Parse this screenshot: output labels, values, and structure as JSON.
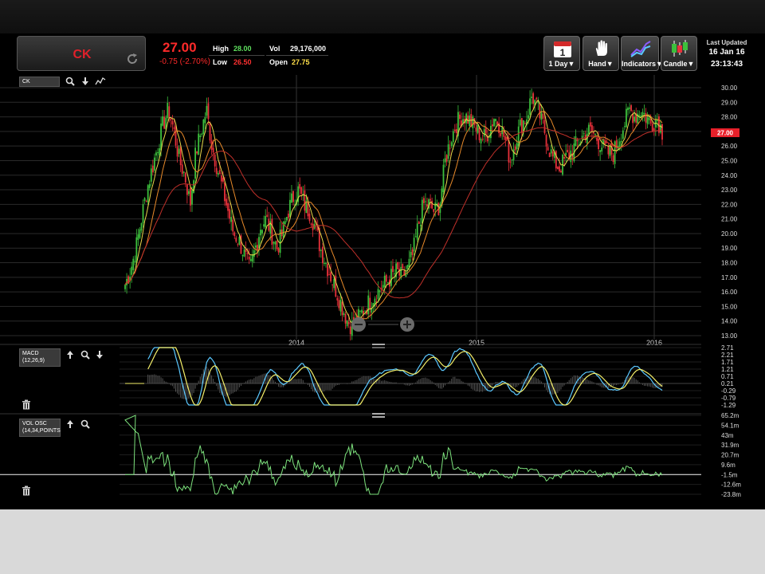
{
  "header": {
    "symbol": "CK",
    "last_price": "27.00",
    "change": "-0.75 (-2.70%)",
    "high_label": "High",
    "high_value": "28.00",
    "low_label": "Low",
    "low_value": "26.50",
    "vol_label": "Vol",
    "vol_value": "29,176,000",
    "open_label": "Open",
    "open_value": "27.75"
  },
  "toolbar": {
    "calendar_day": "1",
    "interval_label": "1 Day▼",
    "hand_label": "Hand▼",
    "indicators_label": "Indicators▼",
    "candle_label": "Candle▼"
  },
  "last_updated": {
    "label": "Last Updated",
    "date": "16 Jan 16",
    "time": "23:13:43"
  },
  "main_panel": {
    "symbol_field": "CK",
    "price_ticks": [
      "30.00",
      "29.00",
      "28.00",
      "27.00",
      "26.00",
      "25.00",
      "24.00",
      "23.00",
      "22.00",
      "21.00",
      "20.00",
      "19.00",
      "18.00",
      "17.00",
      "16.00",
      "15.00",
      "14.00",
      "13.00"
    ],
    "current_price_tag": "27.00",
    "year_labels": [
      "2014",
      "2015",
      "2016"
    ]
  },
  "macd_panel": {
    "label_line1": "MACD",
    "label_line2": "(12,26,9)",
    "ticks": [
      "2.71",
      "2.21",
      "1.71",
      "1.21",
      "0.71",
      "0.21",
      "-0.29",
      "-0.79",
      "-1.29"
    ]
  },
  "vol_panel": {
    "label_line1": "VOL OSC",
    "label_line2": "(14,34,POINTS",
    "ticks": [
      "65.2m",
      "54.1m",
      "43m",
      "31.9m",
      "20.7m",
      "9.6m",
      "-1.5m",
      "-12.6m",
      "-23.8m"
    ]
  },
  "colors": {
    "up": "#3cbf3c",
    "down": "#e8303a",
    "accent_red": "#ff2a2a",
    "high_green": "#5ee05e",
    "open_yellow": "#ffe04a",
    "macd_line": "#5bc8ff",
    "signal_line": "#f5f06a",
    "osc_line": "#7de27d"
  },
  "chart_data": [
    {
      "type": "candlestick",
      "title": "",
      "xlabel": "",
      "ylabel": "",
      "ylim": [
        13,
        30
      ],
      "x_tick_labels": [
        "2014",
        "2015",
        "2016"
      ],
      "approx_daily_closes_start": "2013",
      "closes": [
        16.5,
        17.5,
        19.0,
        21.0,
        23.0,
        24.5,
        26.0,
        27.5,
        28.5,
        27.0,
        25.0,
        24.0,
        22.0,
        25.5,
        27.0,
        28.5,
        26.0,
        24.5,
        23.0,
        21.5,
        20.0,
        19.5,
        18.5,
        17.5,
        19.0,
        20.5,
        21.0,
        20.0,
        19.0,
        20.0,
        21.5,
        22.5,
        23.0,
        22.0,
        21.5,
        20.5,
        19.0,
        18.0,
        17.0,
        16.0,
        15.0,
        14.0,
        13.6,
        14.2,
        14.8,
        15.3,
        15.8,
        16.2,
        16.6,
        17.0,
        17.4,
        17.0,
        17.5,
        18.5,
        20.5,
        22.0,
        22.0,
        21.5,
        22.0,
        25.0,
        26.5,
        27.5,
        28.0,
        28.0,
        27.5,
        27.0,
        26.5,
        27.0,
        28.0,
        27.5,
        26.5,
        25.0,
        26.5,
        27.5,
        28.0,
        29.5,
        28.5,
        27.5,
        26.0,
        25.0,
        24.5,
        25.0,
        25.5,
        26.0,
        26.5,
        27.0,
        27.0,
        26.5,
        26.0,
        25.5,
        25.5,
        26.5,
        27.5,
        28.5,
        28.0,
        28.5,
        28.0,
        27.5,
        28.0,
        27.0
      ],
      "moving_averages": [
        "short",
        "medium",
        "long"
      ]
    },
    {
      "type": "line",
      "title": "",
      "series": [
        {
          "name": "MACD"
        },
        {
          "name": "Signal"
        }
      ],
      "ylim": [
        -1.29,
        2.71
      ]
    },
    {
      "type": "line",
      "title": "",
      "series": [
        {
          "name": "VOL OSC"
        }
      ],
      "ylim": [
        -23.8,
        65.2
      ],
      "unit": "m"
    }
  ]
}
